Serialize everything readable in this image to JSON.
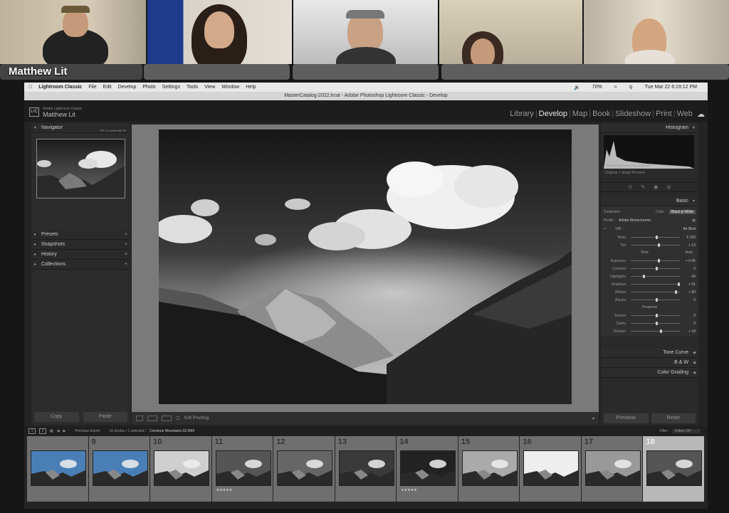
{
  "call": {
    "caller_name": "Matthew Lit"
  },
  "menubar": {
    "items": [
      "Lightroom Classic",
      "File",
      "Edit",
      "Develop",
      "Photo",
      "Settings",
      "Tools",
      "View",
      "Window",
      "Help"
    ],
    "battery": "70%",
    "clock": "Tue Mar 22  6:19:12 PM"
  },
  "window": {
    "title": "MasterCatalog-2022.lrcat - Adobe Photoshop Lightroom Classic - Develop"
  },
  "lr": {
    "app_name": "Adobe Lightroom Classic",
    "user": "Matthew Lit",
    "logo": "LrC",
    "modules": [
      "Library",
      "Develop",
      "Map",
      "Book",
      "Slideshow",
      "Print",
      "Web"
    ],
    "active_module": "Develop"
  },
  "left_panel": {
    "navigator": "Navigator",
    "nav_options": "FIT  1:1  100%  66.7%",
    "panels": [
      "Presets",
      "Snapshots",
      "History",
      "Collections"
    ],
    "copy": "Copy",
    "paste": "Paste"
  },
  "toolbar": {
    "soft_proofing": "Soft Proofing"
  },
  "right_panel": {
    "histogram": "Histogram",
    "hist_values": "ISO 200     50.2 mm     f / 8.0     1/125 sec",
    "hist_status": "Original + Smart Preview",
    "basic": "Basic",
    "treatment_label": "Treatment :",
    "color": "Color",
    "bw": "Black & White",
    "profile_label": "Profile :",
    "profile": "Adobe Monochrome",
    "wb_label": "WB :",
    "wb": "As Shot",
    "tone": "Tone",
    "auto": "Auto",
    "presence": "Presence",
    "sliders": [
      {
        "label": "Temp",
        "value": "5 100",
        "pos": 0.5
      },
      {
        "label": "Tint",
        "value": "+ 13",
        "pos": 0.55
      },
      {
        "label": "Exposure",
        "value": "+ 0.45",
        "pos": 0.55
      },
      {
        "label": "Contrast",
        "value": "0",
        "pos": 0.5
      },
      {
        "label": "Highlights",
        "value": "- 49",
        "pos": 0.25
      },
      {
        "label": "Shadows",
        "value": "+ 91",
        "pos": 0.95
      },
      {
        "label": "Whites",
        "value": "+ 80",
        "pos": 0.9
      },
      {
        "label": "Blacks",
        "value": "0",
        "pos": 0.5
      },
      {
        "label": "Texture",
        "value": "0",
        "pos": 0.5
      },
      {
        "label": "Clarity",
        "value": "0",
        "pos": 0.5
      },
      {
        "label": "Dehaze",
        "value": "+ 18",
        "pos": 0.6
      }
    ],
    "tone_curve": "Tone Curve",
    "bw_panel": "B & W",
    "color_grading": "Color Grading",
    "previous": "Previous",
    "reset": "Reset"
  },
  "filmstrip_bar": {
    "source": "Previous Import",
    "info": "16 photos / 1 selected /",
    "filename": "Crestone Mountains-32.RAF",
    "filter_label": "Filter :",
    "filter": "Filters Off"
  },
  "filmstrip": [
    {
      "num": "",
      "sky": "#4a7fb5",
      "sel": false
    },
    {
      "num": "9",
      "sky": "#4a7fb5",
      "sel": false
    },
    {
      "num": "10",
      "sky": "#cfcfcf",
      "sel": false,
      "stars": ""
    },
    {
      "num": "11",
      "sky": "#555",
      "sel": false,
      "stars": "★★★★★"
    },
    {
      "num": "12",
      "sky": "#666",
      "sel": false
    },
    {
      "num": "13",
      "sky": "#3a3a3a",
      "sel": false
    },
    {
      "num": "14",
      "sky": "#222",
      "sel": false,
      "stars": "★★★★★"
    },
    {
      "num": "15",
      "sky": "#aaa",
      "sel": false
    },
    {
      "num": "16",
      "sky": "#eee",
      "sel": false
    },
    {
      "num": "17",
      "sky": "#999",
      "sel": false
    },
    {
      "num": "18",
      "sky": "#555",
      "sel": true
    }
  ]
}
